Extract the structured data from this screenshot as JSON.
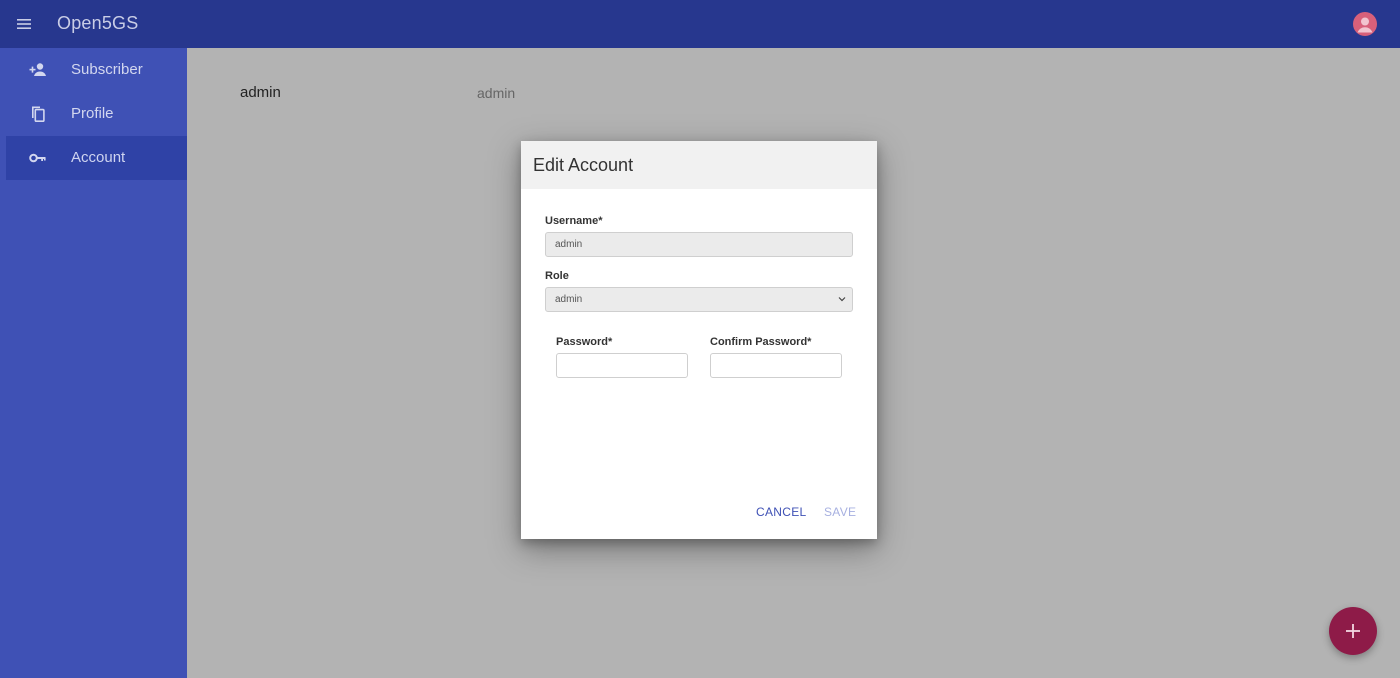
{
  "app": {
    "title": "Open5GS"
  },
  "sidebar": {
    "items": [
      {
        "label": "Subscriber",
        "icon": "add-person-icon"
      },
      {
        "label": "Profile",
        "icon": "copy-icon"
      },
      {
        "label": "Account",
        "icon": "key-icon",
        "active": true
      }
    ]
  },
  "list": {
    "name": "admin",
    "role": "admin"
  },
  "dialog": {
    "title": "Edit Account",
    "username_label": "Username*",
    "username_value": "admin",
    "role_label": "Role",
    "role_value": "admin",
    "password_label": "Password*",
    "password_value": "",
    "confirm_label": "Confirm Password*",
    "confirm_value": "",
    "cancel_label": "CANCEL",
    "save_label": "SAVE"
  },
  "colors": {
    "appbar": "#27378e",
    "sidebar": "#3f51b5",
    "fab": "#8e1b48",
    "accent": "#3f51b5"
  }
}
